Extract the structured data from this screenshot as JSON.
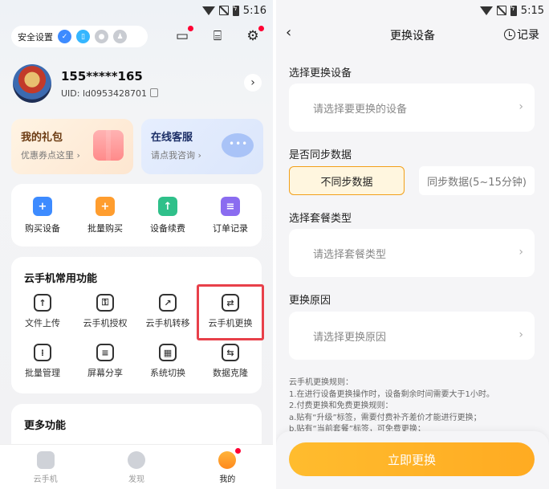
{
  "left": {
    "status": {
      "time": "5:16"
    },
    "security": {
      "label": "安全设置"
    },
    "profile": {
      "phone": "155*****165",
      "uid": "UID: ld0953428701"
    },
    "promos": [
      {
        "title": "我的礼包",
        "subtitle": "优惠券点这里 ›"
      },
      {
        "title": "在线客服",
        "subtitle": "请点我咨询 ›"
      }
    ],
    "actions": [
      {
        "label": "购买设备",
        "icon": "cart-icon",
        "color": "#3d8bff"
      },
      {
        "label": "批量购买",
        "icon": "bag-icon",
        "color": "#ff9d2e"
      },
      {
        "label": "设备续费",
        "icon": "renew-icon",
        "color": "#2fc08a"
      },
      {
        "label": "订单记录",
        "icon": "order-icon",
        "color": "#8a6cf0"
      }
    ],
    "common": {
      "title": "云手机常用功能",
      "items": [
        {
          "label": "文件上传",
          "glyph": "↑"
        },
        {
          "label": "云手机授权",
          "glyph": "⚿"
        },
        {
          "label": "云手机转移",
          "glyph": "↗"
        },
        {
          "label": "云手机更换",
          "glyph": "⇄"
        },
        {
          "label": "批量管理",
          "glyph": "⁞"
        },
        {
          "label": "屏幕分享",
          "glyph": "≡"
        },
        {
          "label": "系统切换",
          "glyph": "▦"
        },
        {
          "label": "数据克隆",
          "glyph": "⇆"
        }
      ]
    },
    "more": {
      "title": "更多功能"
    },
    "tabs": [
      {
        "label": "云手机"
      },
      {
        "label": "发现"
      },
      {
        "label": "我的"
      }
    ]
  },
  "right": {
    "status": {
      "time": "5:15"
    },
    "nav": {
      "title": "更换设备",
      "record": "记录"
    },
    "device": {
      "label": "选择更换设备",
      "placeholder": "请选择要更换的设备"
    },
    "sync": {
      "label": "是否同步数据",
      "option_a": "不同步数据",
      "option_b": "同步数据(5~15分钟)"
    },
    "plan": {
      "label": "选择套餐类型",
      "placeholder": "请选择套餐类型"
    },
    "reason": {
      "label": "更换原因",
      "placeholder": "请选择更换原因"
    },
    "rules": [
      "云手机更换规则：",
      "1.在进行设备更换操作时，设备剩余时间需要大于1小时。",
      "2.付费更换和免费更换规则：",
      "a.贴有“升级”标签，需要付费补齐差价才能进行更换；",
      "b.贴有“当前套餐”标签，可免费更换；"
    ],
    "cta": "立即更换"
  }
}
